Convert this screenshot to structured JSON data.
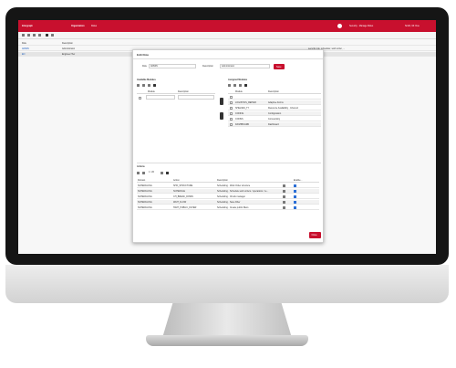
{
  "app": {
    "logo": "Intergraph",
    "module": "Organization",
    "module_sub": "Roles",
    "user_role": "Security · Manage Roles",
    "user_name": "Smith, Mr. Doe"
  },
  "background": {
    "col_role": "Role",
    "col_desc": "Description",
    "rows": [
      [
        "ADMIN",
        "Administrator"
      ],
      [
        "EN",
        "Engineer Tier"
      ]
    ],
    "right_text": "security.role, scheduler, work order, ..."
  },
  "modal": {
    "title": "Edit Role",
    "role_label": "Role",
    "role_value": "ADMIN",
    "desc_label": "Description",
    "desc_value": "Administrator",
    "save_label": "Save",
    "available_title": "Available Modules",
    "assigned_title": "Assigned Modules",
    "col_module": "Module",
    "col_description": "Description",
    "assigned": [
      {
        "module": "",
        "description": ""
      },
      {
        "module": "LOGISTICS_REPAIR",
        "description": "Adaptive Forms"
      },
      {
        "module": "SHELVES_TY",
        "description": "Resource Availability · Inbound"
      },
      {
        "module": "CONFIG",
        "description": "Configuration"
      },
      {
        "module": "CONNS",
        "description": "Connectivity"
      },
      {
        "module": "DASHBOARD",
        "description": "Dashboard"
      }
    ],
    "actions_title": "Actions",
    "count_text": "1 / 20",
    "col_domain": "Domain",
    "col_action": "Action",
    "col_enabled": "Enable...",
    "actions": [
      {
        "domain": "SCHEDULING",
        "action": "SHO_STRUCTURE",
        "description": "Scheduling · Work Order structure"
      },
      {
        "domain": "SCHEDULING",
        "action": "SCHEDULE",
        "description": "Scheduling · Schedule work orders / operations / re..."
      },
      {
        "domain": "SCHEDULING",
        "action": "CH_BREAK_DOWN",
        "description": "Scheduling · Chunk manager"
      },
      {
        "domain": "SCHEDULING",
        "action": "WAIT_FLOW",
        "description": "Scheduling · Save Filter"
      },
      {
        "domain": "SCHEDULING",
        "action": "SWIT_PUBLIC_FILTER",
        "description": "Scheduling · Create public filters"
      }
    ],
    "close_label": "Close"
  }
}
